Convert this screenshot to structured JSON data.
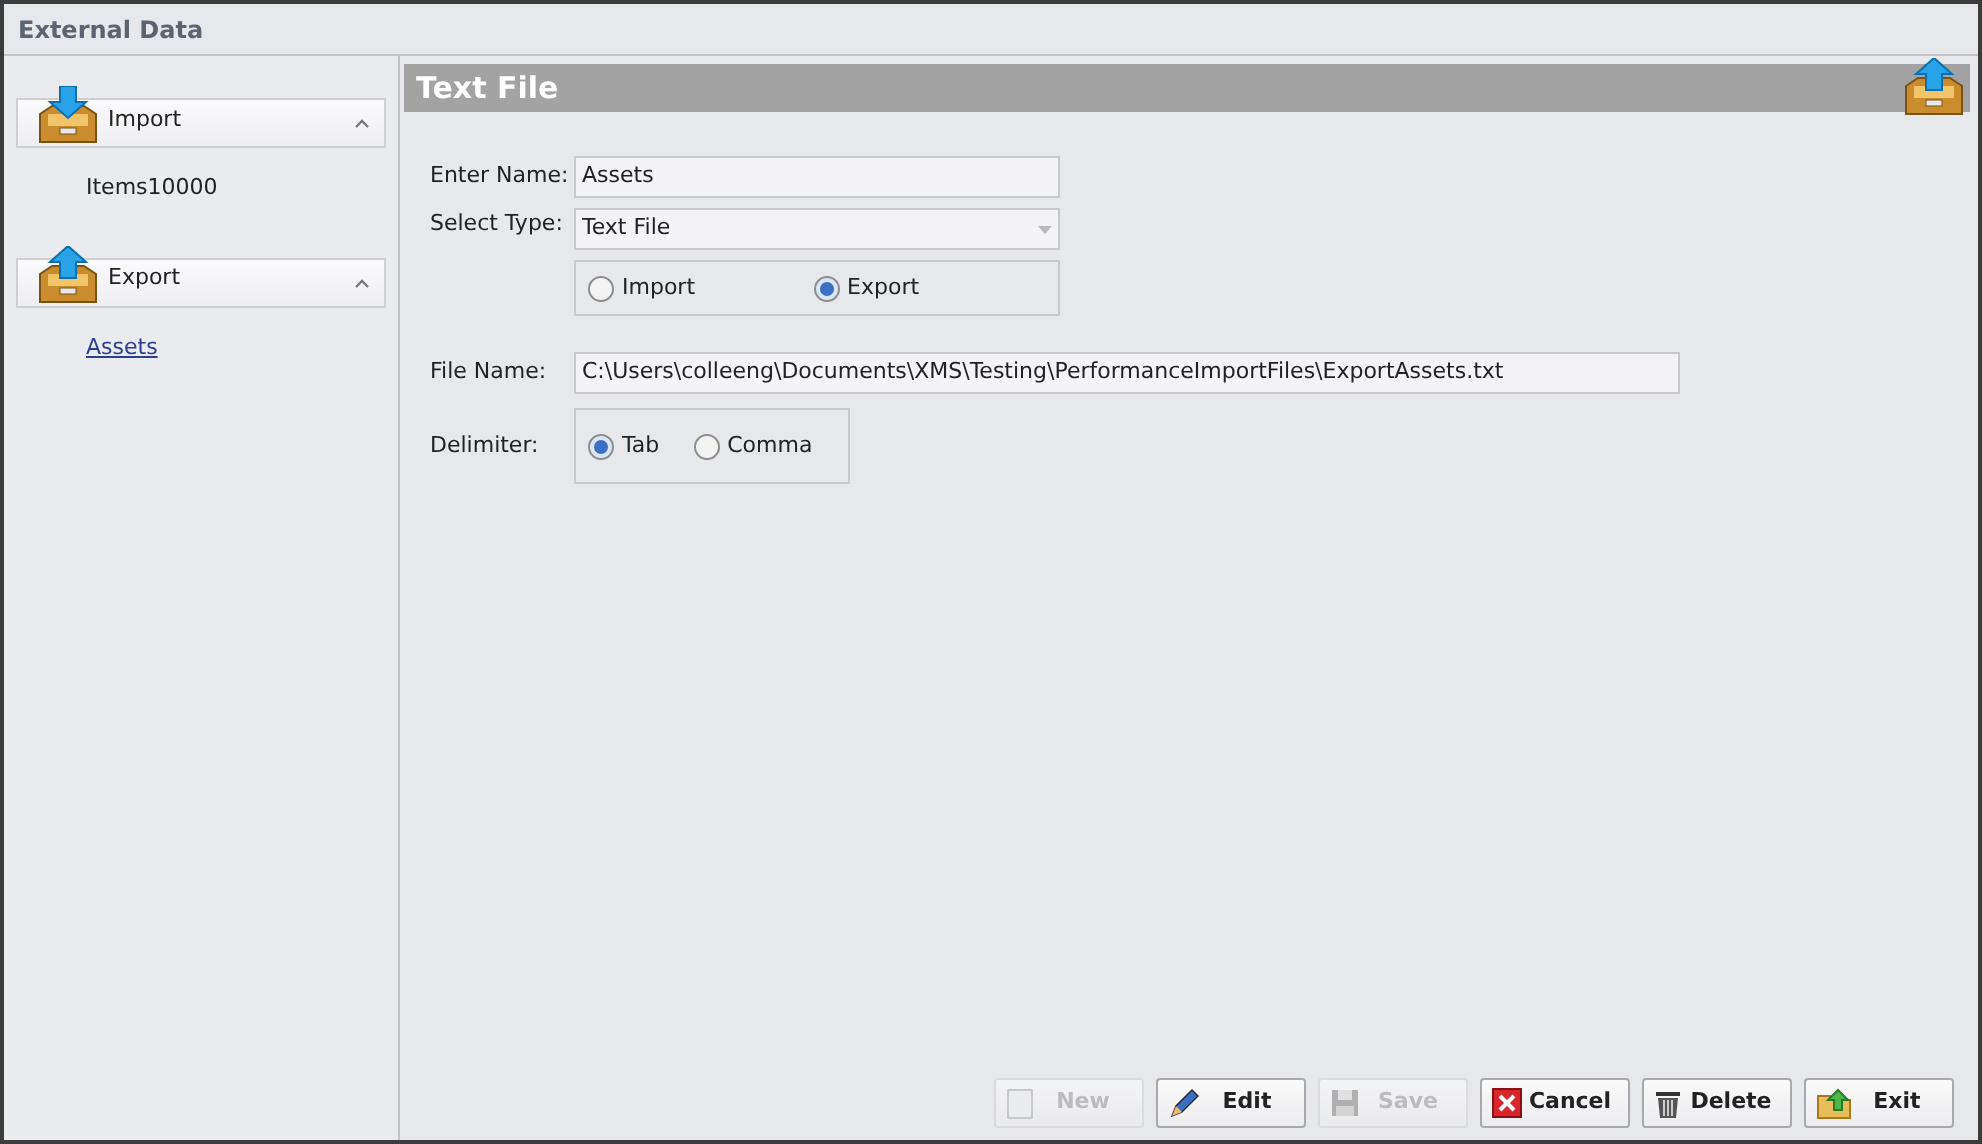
{
  "window": {
    "title": "External Data"
  },
  "sidebar": {
    "groups": [
      {
        "kind": "import",
        "label": "Import",
        "expanded": true,
        "items": [
          {
            "label": "Items10000",
            "selected": false
          }
        ]
      },
      {
        "kind": "export",
        "label": "Export",
        "expanded": true,
        "items": [
          {
            "label": "Assets",
            "selected": true
          }
        ]
      }
    ]
  },
  "panel": {
    "title": "Text File",
    "name": {
      "label": "Enter Name:",
      "value": "Assets"
    },
    "type": {
      "label": "Select Type:",
      "value": "Text File"
    },
    "direction": [
      {
        "label": "Import",
        "selected": false
      },
      {
        "label": "Export",
        "selected": true
      }
    ],
    "file": {
      "label": "File Name:",
      "value": "C:\\Users\\colleeng\\Documents\\XMS\\Testing\\PerformanceImportFiles\\ExportAssets.txt"
    },
    "delimiter": {
      "label": "Delimiter:",
      "options": [
        {
          "label": "Tab",
          "selected": true
        },
        {
          "label": "Comma",
          "selected": false
        }
      ]
    }
  },
  "buttons": [
    {
      "kind": "new",
      "label": "New",
      "disabled": true
    },
    {
      "kind": "edit",
      "label": "Edit",
      "disabled": false
    },
    {
      "kind": "save",
      "label": "Save",
      "disabled": true
    },
    {
      "kind": "cancel",
      "label": "Cancel",
      "disabled": false
    },
    {
      "kind": "delete",
      "label": "Delete",
      "disabled": false
    },
    {
      "kind": "exit",
      "label": "Exit",
      "disabled": false
    }
  ]
}
